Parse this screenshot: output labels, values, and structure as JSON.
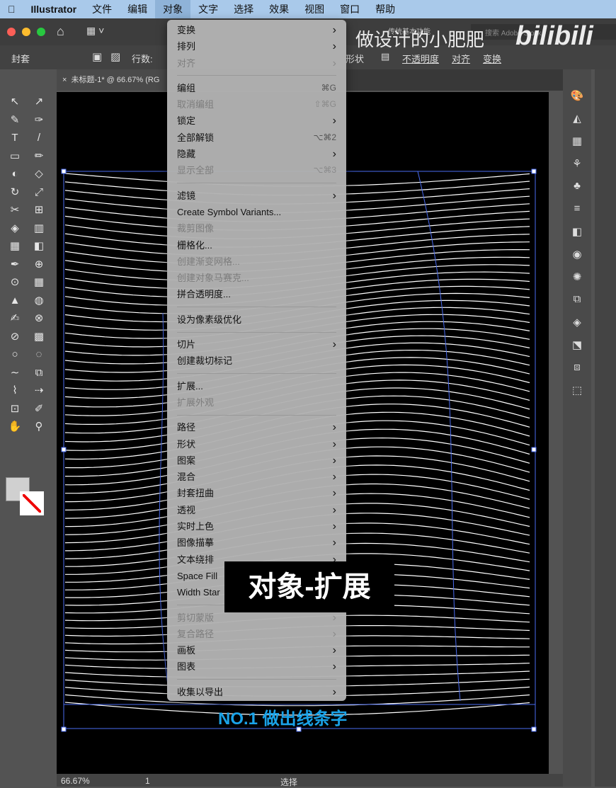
{
  "menubar": {
    "app": "Illustrator",
    "items": [
      "文件",
      "编辑",
      "对象",
      "文字",
      "选择",
      "效果",
      "视图",
      "窗口",
      "帮助"
    ]
  },
  "titlebar": {
    "workspace": "传统基本功能",
    "search_placeholder": "搜索 Adobe Stock"
  },
  "controlbar": {
    "mode": "封套",
    "rows_label": "行数:",
    "shape": "形状",
    "opacity": "不透明度",
    "align": "对齐",
    "transform": "变换"
  },
  "document_tab": {
    "title": "未标题-1* @ 66.67% (RG"
  },
  "menu": {
    "groups": [
      [
        {
          "label": "变换",
          "sub": true
        },
        {
          "label": "排列",
          "sub": true
        },
        {
          "label": "对齐",
          "sub": true,
          "disabled": true
        }
      ],
      [
        {
          "label": "编组",
          "shortcut": "⌘G"
        },
        {
          "label": "取消编组",
          "shortcut": "⇧⌘G",
          "disabled": true
        },
        {
          "label": "锁定",
          "sub": true
        },
        {
          "label": "全部解锁",
          "shortcut": "⌥⌘2"
        },
        {
          "label": "隐藏",
          "sub": true
        },
        {
          "label": "显示全部",
          "shortcut": "⌥⌘3",
          "disabled": true
        }
      ],
      [
        {
          "label": "滤镜",
          "sub": true
        },
        {
          "label": "Create Symbol Variants..."
        },
        {
          "label": "裁剪图像",
          "disabled": true
        },
        {
          "label": "栅格化..."
        },
        {
          "label": "创建渐变网格...",
          "disabled": true
        },
        {
          "label": "创建对象马赛克...",
          "disabled": true
        },
        {
          "label": "拼合透明度..."
        }
      ],
      [
        {
          "label": "设为像素级优化"
        }
      ],
      [
        {
          "label": "切片",
          "sub": true
        },
        {
          "label": "创建裁切标记"
        }
      ],
      [
        {
          "label": "扩展..."
        },
        {
          "label": "扩展外观",
          "disabled": true
        }
      ],
      [
        {
          "label": "路径",
          "sub": true
        },
        {
          "label": "形状",
          "sub": true
        },
        {
          "label": "图案",
          "sub": true
        },
        {
          "label": "混合",
          "sub": true
        },
        {
          "label": "封套扭曲",
          "sub": true
        },
        {
          "label": "透视",
          "sub": true
        },
        {
          "label": "实时上色",
          "sub": true
        },
        {
          "label": "图像描摹",
          "sub": true
        },
        {
          "label": "文本绕排",
          "sub": true
        },
        {
          "label": "Space Fill",
          "sub": true
        },
        {
          "label": "Width Star",
          "sub": true
        }
      ],
      [
        {
          "label": "剪切蒙版",
          "sub": true,
          "disabled": true
        },
        {
          "label": "复合路径",
          "sub": true,
          "disabled": true
        },
        {
          "label": "画板",
          "sub": true
        },
        {
          "label": "图表",
          "sub": true
        }
      ],
      [
        {
          "label": "收集以导出",
          "sub": true
        }
      ]
    ]
  },
  "overlay": {
    "caption": "对象-扩展",
    "subtitle": "NO.1 做出线条字",
    "watermark": "做设计的小肥肥",
    "logo": "bilibili"
  },
  "status": {
    "zoom": "66.67%",
    "page": "1",
    "tool": "选择"
  },
  "colors": {
    "accent": "#1aa3e8",
    "selection": "#4a6cf0",
    "menubar": "#a9c9ea"
  }
}
